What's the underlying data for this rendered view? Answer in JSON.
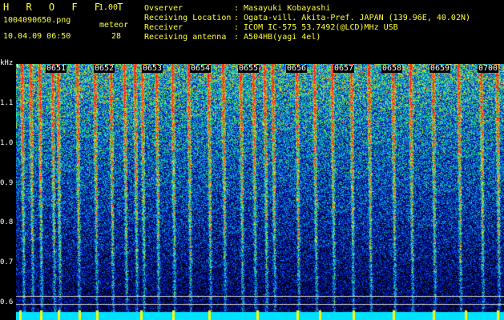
{
  "header": {
    "app_name": "H R O F F T",
    "version": "1.00",
    "filename": "1004090650.png",
    "datetime": "10.04.09 06:50",
    "count_label": "meteor",
    "count_value": "28",
    "info_labels": [
      "Ovserver",
      "Receiving Location",
      "Receiver",
      "Receiving antenna"
    ],
    "info_values": [
      ": Masayuki Kobayashi",
      ": Ogata-vill. Akita-Pref. JAPAN (139.96E, 40.02N)",
      ": ICOM IC-575 53.7492(@LCD)MHz USB",
      ": A504HB(yagi 4el)"
    ]
  },
  "spectrogram": {
    "y_unit": "kHz",
    "y_ticks": [
      "1.1",
      "1.0",
      "0.9",
      "0.8",
      "0.7",
      "0.6"
    ],
    "time_ticks": [
      "0651",
      "0652",
      "0653",
      "0654",
      "0655",
      "0656",
      "0657",
      "0658",
      "0659",
      "0700"
    ],
    "colors": {
      "text_yellow": "#ffff3c",
      "text_white": "#ffffff",
      "band_cyan": "#00e0ff",
      "marker_yellow": "#ffff00"
    }
  }
}
